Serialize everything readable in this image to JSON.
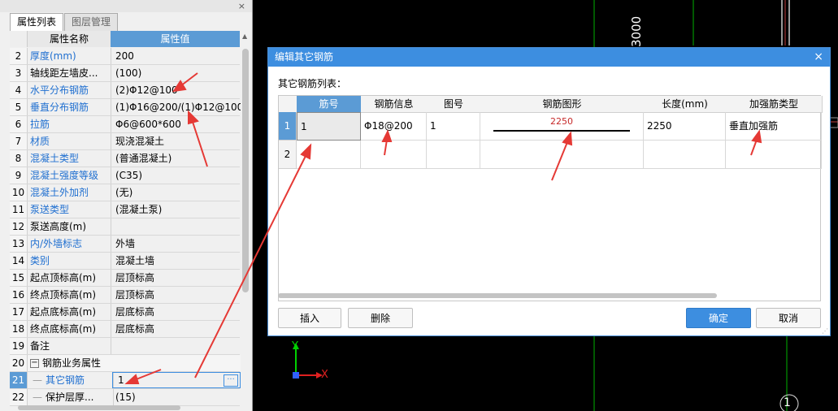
{
  "left_panel": {
    "close_icon": "×",
    "tabs": [
      "属性列表",
      "图层管理"
    ],
    "header": {
      "name": "属性名称",
      "value": "属性值"
    },
    "rows": [
      {
        "no": "2",
        "name": "厚度(mm)",
        "value": "200",
        "blue": true
      },
      {
        "no": "3",
        "name": "轴线距左墙皮...",
        "value": "(100)",
        "blue": false
      },
      {
        "no": "4",
        "name": "水平分布钢筋",
        "value": "(2)Φ12@100",
        "blue": true
      },
      {
        "no": "5",
        "name": "垂直分布钢筋",
        "value": "(1)Φ16@200/(1)Φ12@100",
        "blue": true
      },
      {
        "no": "6",
        "name": "拉筋",
        "value": "Φ6@600*600",
        "blue": true
      },
      {
        "no": "7",
        "name": "材质",
        "value": "现浇混凝土",
        "blue": true
      },
      {
        "no": "8",
        "name": "混凝土类型",
        "value": "(普通混凝土)",
        "blue": true
      },
      {
        "no": "9",
        "name": "混凝土强度等级",
        "value": "(C35)",
        "blue": true
      },
      {
        "no": "10",
        "name": "混凝土外加剂",
        "value": "(无)",
        "blue": true
      },
      {
        "no": "11",
        "name": "泵送类型",
        "value": "(混凝土泵)",
        "blue": true
      },
      {
        "no": "12",
        "name": "泵送高度(m)",
        "value": "",
        "blue": false
      },
      {
        "no": "13",
        "name": "内/外墙标志",
        "value": "外墙",
        "blue": true
      },
      {
        "no": "14",
        "name": "类别",
        "value": "混凝土墙",
        "blue": true
      },
      {
        "no": "15",
        "name": "起点顶标高(m)",
        "value": "层顶标高",
        "blue": false
      },
      {
        "no": "16",
        "name": "终点顶标高(m)",
        "value": "层顶标高",
        "blue": false
      },
      {
        "no": "17",
        "name": "起点底标高(m)",
        "value": "层底标高",
        "blue": false
      },
      {
        "no": "18",
        "name": "终点底标高(m)",
        "value": "层底标高",
        "blue": false
      },
      {
        "no": "19",
        "name": "备注",
        "value": "",
        "blue": false
      },
      {
        "no": "20",
        "name": "钢筋业务属性",
        "value": "",
        "blue": false,
        "group": true
      },
      {
        "no": "21",
        "name": "其它钢筋",
        "value": "1",
        "blue": true,
        "selected": true
      },
      {
        "no": "22",
        "name": "保护层厚...",
        "value": "(15)",
        "blue": false
      }
    ],
    "collapse_symbol": "−",
    "ellipsis": "···"
  },
  "canvas": {
    "dimension_text": "3000",
    "axis_x": "X",
    "axis_y": "Y",
    "grid_marker": "1"
  },
  "dialog": {
    "title": "编辑其它钢筋",
    "close_icon": "×",
    "list_label": "其它钢筋列表：",
    "columns": [
      "筋号",
      "钢筋信息",
      "图号",
      "钢筋图形",
      "长度(mm)",
      "加强筋类型"
    ],
    "rows": [
      {
        "no": "1",
        "cells": [
          "1",
          "Φ18@200",
          "1",
          "2250",
          "2250",
          "垂直加强筋"
        ]
      },
      {
        "no": "2",
        "cells": [
          "",
          "",
          "",
          "",
          "",
          ""
        ]
      }
    ],
    "buttons": {
      "insert": "插入",
      "delete": "删除",
      "ok": "确定",
      "cancel": "取消"
    }
  },
  "colors": {
    "accent": "#3d8ee0",
    "annotation": "#e53935",
    "cad_green": "#00c000"
  }
}
